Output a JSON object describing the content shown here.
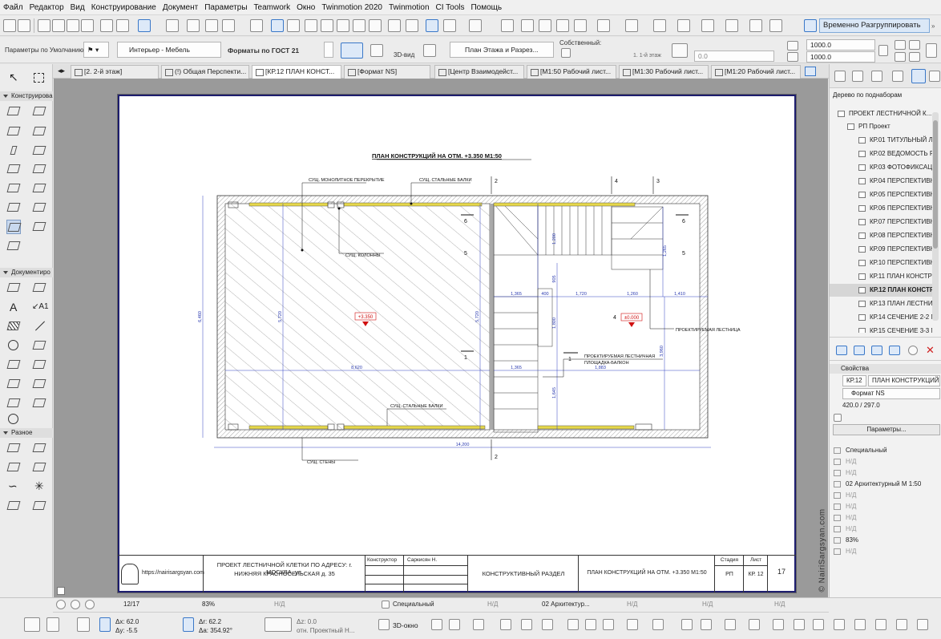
{
  "menu": [
    "Файл",
    "Редактор",
    "Вид",
    "Конструирование",
    "Документ",
    "Параметры",
    "Teamwork",
    "Окно",
    "Twinmotion 2020",
    "Twinmotion",
    "CI Tools",
    "Помощь"
  ],
  "toolbar": {
    "ungroup_label": "Временно Разгруппировать",
    "default_params": "Параметры по Умолчанию",
    "layer_combo": "Интерьер - Мебель",
    "format_label": "Форматы по ГОСТ 21",
    "view_3d": "3D-вид",
    "floor_plan_combo": "План Этажа и Разрез...",
    "own_label": "Собственный:",
    "floor_label": "1. 1-й этаж",
    "angle_value": "0.0",
    "dim1": "1000.0",
    "dim2": "1000.0"
  },
  "tabs": [
    {
      "label": "[2. 2-й этаж]"
    },
    {
      "label": "(!) Общая Перспекти..."
    },
    {
      "label": "[КР.12 ПЛАН КОНСТ..."
    },
    {
      "label": "[Формат NS]"
    },
    {
      "label": "[Центр Взаимодейст..."
    },
    {
      "label": "[М1:50 Рабочий лист..."
    },
    {
      "label": "[М1:30 Рабочий лист..."
    },
    {
      "label": "[М1:20 Рабочий лист..."
    }
  ],
  "palette": {
    "construction": "Конструирова",
    "documentation": "Документиро",
    "misc": "Разное"
  },
  "drawing": {
    "title": "ПЛАН КОНСТРУКЦИЙ НА ОТМ. +3.350  М1:50",
    "callouts": {
      "slab": "СУЩ. МОНОЛИТНОЕ ПЕРЕКРЫТИЕ",
      "beams_top": "СУЩ. СТАЛЬНЫЕ БАЛКИ",
      "columns": "СУЩ. КОЛОННЫ",
      "beams_bottom": "СУЩ. СТАЛЬНЫЕ БАЛКИ",
      "walls": "СУЩ. СТЕНЫ",
      "stair": "ПРОЕКТИРУЕМАЯ ЛЕСТНИЦА",
      "platform_1": "ПРОЕКТИРУЕМАЯ ЛЕСТНИЧНАЯ",
      "platform_2": "ПЛОЩАДКА-БАЛКОН"
    },
    "levels": {
      "left": "+3.350",
      "right": "±0.000"
    },
    "axes": {
      "a2": "2",
      "a4": "4",
      "a3": "3",
      "a2b": "2"
    },
    "sections": {
      "s1": "1",
      "s1b": "1",
      "s4": "4",
      "s5": "5",
      "s5b": "5",
      "s6": "6",
      "s6b": "6"
    },
    "dims": {
      "overall": "14,200",
      "inner": "8,620",
      "height": "6,460",
      "left_h": "5,720",
      "mid_h": "5,720",
      "right_h": "3,960",
      "stair_w1": "1,365",
      "stair_w2": "400",
      "stair_w3": "1,720",
      "stair_w4": "1,260",
      "stair_w5": "1,410",
      "stair_run": "1,800",
      "lower_a": "1,365",
      "lower_b": "1,883",
      "stair_v1": "1,200",
      "stair_v2": "1,265",
      "stair_v3": "905",
      "stair_v4": "1,645"
    }
  },
  "titleblock": {
    "website": "https://nairisargsyan.com",
    "project": "ПРОЕКТ ЛЕСТНИЧНОЙ КЛЕТКИ ПО АДРЕСУ:  г. МОСКВА, ул.",
    "address": "НИЖНЯЯ КРАСНОСЕЛЬСКАЯ д. 35",
    "role": "Конструктор",
    "name": "Саркисян Н.",
    "section": "КОНСТРУКТИВНЫЙ РАЗДЕЛ",
    "sheet_title": "ПЛАН КОНСТРУКЦИЙ НА ОТМ. +3.350  М1:50",
    "stage_h": "Стадия",
    "sheet_h": "Лист",
    "stage": "РП",
    "sheet": "КР. 12",
    "total": "17"
  },
  "navigator": {
    "header": "Дерево по поднаборам",
    "root": "ПРОЕКТ ЛЕСТНИЧНОЙ К...",
    "subset": "РП Проект",
    "items": [
      "КР.01 ТИТУЛЬНЫЙ ЛИ",
      "КР.02 ВЕДОМОСТЬ РА",
      "КР.03 ФОТОФИКСАЦИ",
      "КР.04 ПЕРСПЕКТИВНЬ",
      "КР.05 ПЕРСПЕКТИВНЬ",
      "КР.06 ПЕРСПЕКТИВНЬ",
      "КР.07 ПЕРСПЕКТИВНЬ",
      "КР.08 ПЕРСПЕКТИВНЬ",
      "КР.09 ПЕРСПЕКТИВНЬ",
      "КР.10 ПЕРСПЕКТИВНЬ",
      "КР.11 ПЛАН КОНСТРУ",
      "КР.12 ПЛАН КОНСТР",
      "КР.13 ПЛАН ЛЕСТНИ",
      "КР.14 СЕЧЕНИЕ 2-2  М",
      "КР.15 СЕЧЕНИЕ 3-3  М"
    ],
    "selected_index": 11
  },
  "properties": {
    "header": "Свойства",
    "id": "КР.12",
    "name": "ПЛАН КОНСТРУКЦИЙ Н",
    "format": "Формат NS",
    "size": "420.0 / 297.0",
    "params_button": "Параметры...",
    "rows": [
      "Специальный",
      "Н/Д",
      "Н/Д",
      "02 Архитектурный М 1:50",
      "Н/Д",
      "Н/Д",
      "Н/Д",
      "Н/Д",
      "83%",
      "Н/Д"
    ]
  },
  "watermark": "© NairiSargsyan.com",
  "status": {
    "page": "12/17",
    "zoom": "83%",
    "nd1": "Н/Д",
    "special": "Специальный",
    "nd2": "Н/Д",
    "arch": "02 Архитектур...",
    "nd3": "Н/Д",
    "nd4": "Н/Д",
    "nd5": "Н/Д",
    "dx": "Δx: 62.0",
    "dy": "Δy: -5.5",
    "dr": "Δr: 62.2",
    "da": "Δa: 354.92°",
    "dz": "Δz: 0.0",
    "ref": "отн. Проектный Н...",
    "view3d": "3D-окно"
  }
}
